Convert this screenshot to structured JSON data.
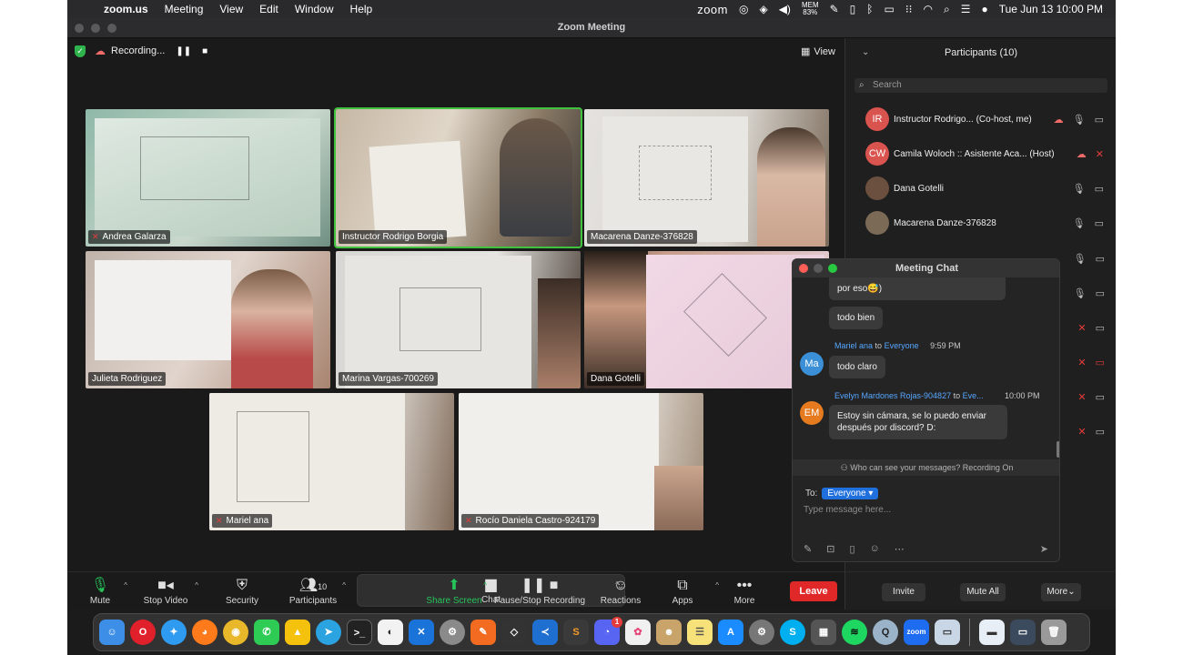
{
  "menubar": {
    "app": "zoom.us",
    "items": [
      "Meeting",
      "View",
      "Edit",
      "Window",
      "Help"
    ],
    "zoom_word": "zoom",
    "mem_label": "MEM",
    "mem_value": "83%",
    "datetime": "Tue Jun 13  10:00 PM"
  },
  "window": {
    "title": "Zoom Meeting"
  },
  "recording": {
    "label": "Recording...",
    "view_label": "View"
  },
  "tiles": [
    {
      "name": "Andrea Galarza",
      "muted": true
    },
    {
      "name": "Instructor Rodrigo Borgia",
      "muted": false
    },
    {
      "name": "Macarena Danze-376828",
      "muted": false
    },
    {
      "name": "Julieta Rodriguez",
      "muted": false
    },
    {
      "name": "Marina Vargas-700269",
      "muted": false
    },
    {
      "name": "Dana Gotelli",
      "muted": false
    },
    {
      "name": "Mariel ana",
      "muted": true
    },
    {
      "name": "Rocío Daniela  Castro-924179",
      "muted": true
    }
  ],
  "toolbar": {
    "mute": "Mute",
    "stop_video": "Stop Video",
    "security": "Security",
    "participants": "Participants",
    "participants_count": "10",
    "chat": "Chat",
    "share_screen": "Share Screen",
    "pause_recording": "Pause/Stop Recording",
    "reactions": "Reactions",
    "apps": "Apps",
    "more": "More",
    "leave": "Leave"
  },
  "participants_panel": {
    "title": "Participants (10)",
    "search_placeholder": "Search",
    "rows": [
      {
        "initials": "IR",
        "name": "Instructor Rodrigo...  (Co-host, me)",
        "color": "#d9534f"
      },
      {
        "initials": "CW",
        "name": "Camila Woloch :: Asistente Aca...  (Host)",
        "color": "#d9534f"
      },
      {
        "initials": "",
        "name": "Dana Gotelli",
        "color": "#6b4f3f"
      },
      {
        "initials": "",
        "name": "Macarena Danze-376828",
        "color": "#7b6a55"
      }
    ],
    "invite": "Invite",
    "mute_all": "Mute All",
    "more": "More"
  },
  "chat": {
    "title": "Meeting Chat",
    "messages": [
      {
        "text": "por eso😅)"
      },
      {
        "text": "todo bien"
      },
      {
        "sender": "Mariel ana",
        "to": "to",
        "recipient": "Everyone",
        "time": "9:59 PM",
        "initials": "Ma",
        "text": "todo claro"
      },
      {
        "sender": "Evelyn Mardones Rojas-904827",
        "to": "to",
        "recipient": "Eve...",
        "time": "10:00 PM",
        "initials": "EM",
        "text": "Estoy sin cámara, se lo puedo enviar después por discord? D:"
      }
    ],
    "notice": "Who can see your messages? Recording On",
    "to_label": "To:",
    "to_value": "Everyone",
    "input_placeholder": "Type message here..."
  },
  "colors": {
    "accent_green": "#26c45a",
    "leave_red": "#e02828",
    "link_blue": "#56a6ff",
    "avatar_ma": "#3a8fd6",
    "avatar_em": "#e57a1f"
  },
  "dock": {
    "apps": [
      "finder",
      "opera",
      "safari",
      "firefox",
      "chrome",
      "whatsapp",
      "drive",
      "telegram",
      "terminal",
      "github",
      "xcode",
      "settings",
      "sublime-like",
      "unity",
      "vscode",
      "sublime",
      "discord",
      "photos",
      "notes-app",
      "notes",
      "appstore",
      "system-preferences",
      "skype",
      "calculator",
      "spotify",
      "quicktime",
      "zoom",
      "preview",
      "folder",
      "screens",
      "trash"
    ],
    "zoom_label": "zoom",
    "discord_badge": "1"
  }
}
